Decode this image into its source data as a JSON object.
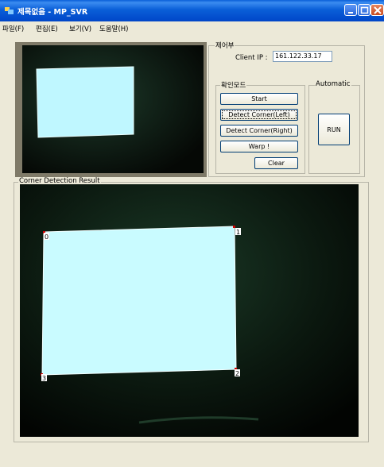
{
  "window": {
    "title": "제목없음 - MP_SVR"
  },
  "menu": {
    "items": [
      "파일(F)",
      "편집(E)",
      "보기(V)",
      "도움말(H)"
    ]
  },
  "control_group": {
    "label": "제어부",
    "client_ip_label": "Client IP :",
    "client_ip_value": "161.122.33.17"
  },
  "check_mode_group": {
    "label": "확인모드",
    "buttons": {
      "start": "Start",
      "detect_left": "Detect Corner(Left)",
      "detect_right": "Detect Corner(Right)",
      "warp": "Warp !",
      "clear": "Clear"
    }
  },
  "automatic_group": {
    "label": "Automatic",
    "run_label": "RUN"
  },
  "result_group": {
    "label": "Corner Detection Result",
    "corner_labels": [
      "0",
      "1",
      "2",
      "3"
    ]
  },
  "colors": {
    "screen_cyan": "#c9fbff",
    "titlebar_blue": "#0a5fd8",
    "dialog_bg": "#ece9d8",
    "corner_marker": "#d00000"
  },
  "icons": {
    "app": "app-window-icon",
    "minimize": "minimize-icon",
    "maximize": "maximize-icon",
    "close": "close-icon"
  }
}
